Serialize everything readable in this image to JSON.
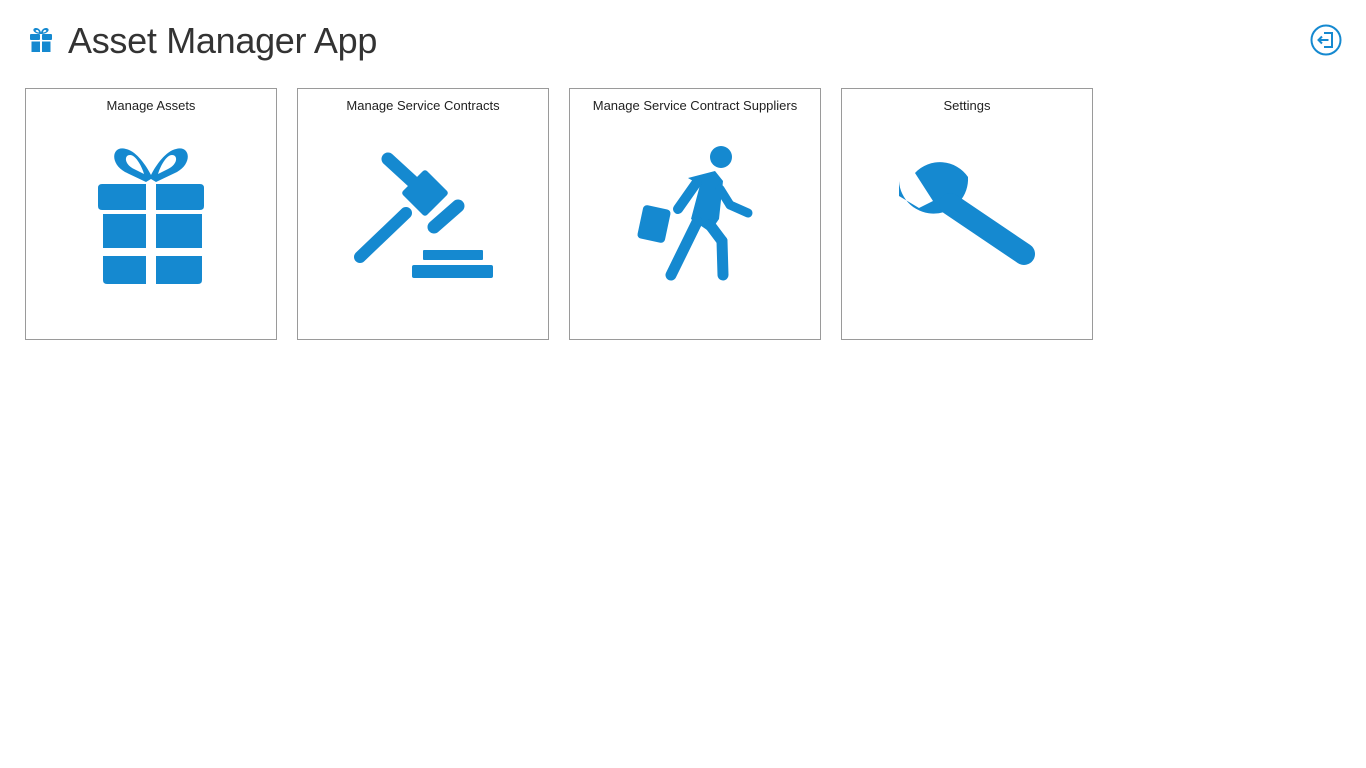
{
  "app": {
    "title": "Asset Manager App",
    "icon": "gift-icon",
    "logout_icon": "sign-out-icon"
  },
  "colors": {
    "accent": "#1589d0",
    "tile_border": "#9a9a9a",
    "background": "#ffffff"
  },
  "tiles": [
    {
      "label": "Manage Assets",
      "icon": "gift-icon"
    },
    {
      "label": "Manage Service Contracts",
      "icon": "gavel-icon"
    },
    {
      "label": "Manage Service Contract Suppliers",
      "icon": "walking-person-icon"
    },
    {
      "label": "Settings",
      "icon": "wrench-icon"
    }
  ]
}
